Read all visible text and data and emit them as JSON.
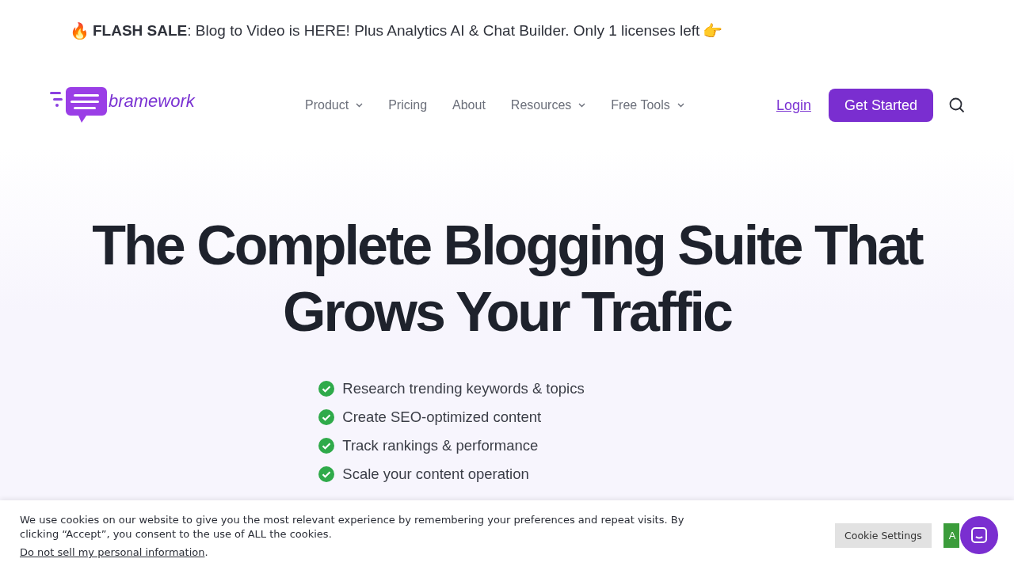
{
  "announcement": {
    "emoji_start": "🔥",
    "label": "FLASH SALE",
    "message": ": Blog to Video is HERE! Plus Analytics AI & Chat Builder. Only 1 licenses left",
    "emoji_end": "👉"
  },
  "header": {
    "logo_text": "bramework",
    "nav": [
      {
        "label": "Product",
        "dropdown": true
      },
      {
        "label": "Pricing",
        "dropdown": false
      },
      {
        "label": "About",
        "dropdown": false
      },
      {
        "label": "Resources",
        "dropdown": true
      },
      {
        "label": "Free Tools",
        "dropdown": true
      }
    ],
    "login": "Login",
    "cta": "Get Started"
  },
  "hero": {
    "title": "The Complete Blogging Suite That Grows Your Traffic",
    "features": [
      "Research trending keywords & topics",
      "Create SEO-optimized content",
      "Track rankings & performance",
      "Scale your content operation"
    ]
  },
  "cookie_banner": {
    "text": "We use cookies on our website to give you the most relevant experience by remembering your preferences and repeat visits. By clicking “Accept”, you consent to the use of ALL the cookies.",
    "optout_link": "Do not sell my personal information",
    "optout_suffix": ".",
    "settings_button": "Cookie Settings",
    "accept_button": "A"
  }
}
